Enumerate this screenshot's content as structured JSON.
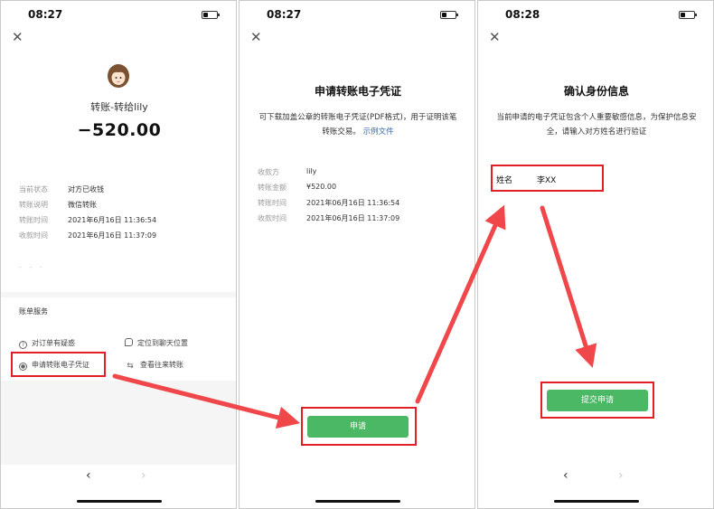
{
  "screen1": {
    "time": "08:27",
    "title": "转账-转给lily",
    "amount": "−520.00",
    "details": [
      {
        "label": "当前状态",
        "value": "对方已收钱"
      },
      {
        "label": "转账说明",
        "value": "微信转账"
      },
      {
        "label": "转账时间",
        "value": "2021年6月16日 11:36:54"
      },
      {
        "label": "收款时间",
        "value": "2021年6月16日 11:37:09"
      }
    ],
    "section_title": "账单服务",
    "services": {
      "doubt": "对订单有疑惑",
      "locate": "定位到聊天位置",
      "voucher": "申请转账电子凭证",
      "history": "查看往来转账"
    },
    "nav_back": "‹",
    "nav_forward": "›"
  },
  "screen2": {
    "time": "08:27",
    "title": "申请转账电子凭证",
    "desc": "可下载加盖公章的转账电子凭证(PDF格式)，用于证明该笔转账交易。",
    "sample_link": "示例文件",
    "details": [
      {
        "label": "收款方",
        "value": "lily"
      },
      {
        "label": "转账金额",
        "value": "¥520.00"
      },
      {
        "label": "转账时间",
        "value": "2021年06月16日 11:36:54"
      },
      {
        "label": "收款时间",
        "value": "2021年06月16日 11:37:09"
      }
    ],
    "apply_label": "申请"
  },
  "screen3": {
    "time": "08:28",
    "title": "确认身份信息",
    "desc": "当前申请的电子凭证包含个人重要敏感信息，为保护信息安全，请输入对方姓名进行验证",
    "name_label": "姓名",
    "name_value": "李XX",
    "submit_label": "提交申请",
    "nav_back": "‹",
    "nav_forward": "›"
  },
  "colors": {
    "accent_green": "#4bb866",
    "highlight_red": "#e31e24",
    "arrow_red": "#f0474b",
    "link_blue": "#3a6aa8"
  }
}
